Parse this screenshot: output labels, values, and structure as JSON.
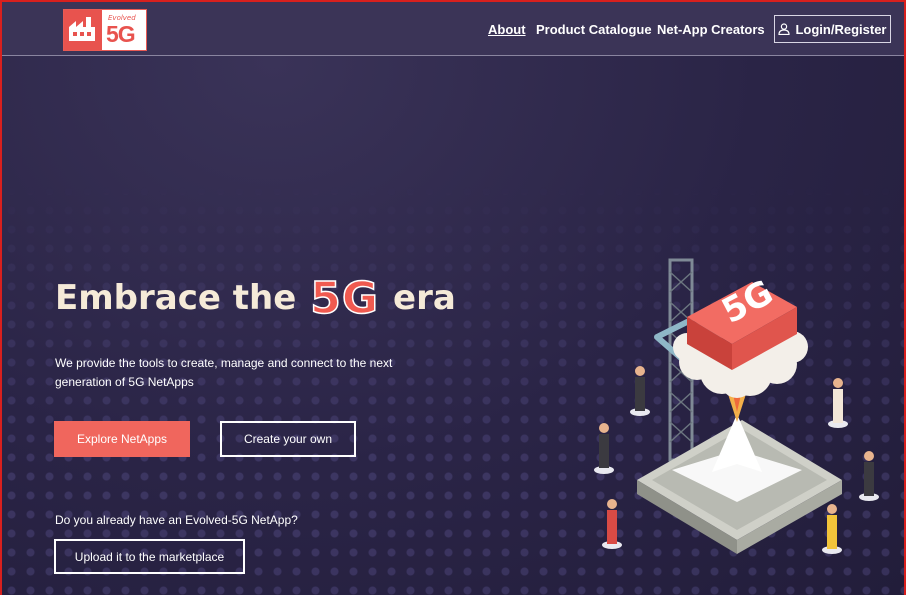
{
  "header": {
    "logo": {
      "small_text": "Evolved",
      "big_text": "5G"
    },
    "nav": {
      "about": "About",
      "catalogue": "Product Catalogue",
      "creators": "Net-App Creators",
      "login": "Login/Register"
    }
  },
  "hero": {
    "headline_before": "Embrace the",
    "headline_accent": "5G",
    "headline_after": "era",
    "subtext": "We provide the tools to create, manage and connect to the next generation of 5G NetApps",
    "explore_button": "Explore NetApps",
    "create_button": "Create your own",
    "question": "Do you already have an Evolved-5G NetApp?",
    "upload_button": "Upload it to the marketplace",
    "illustration_label": "5G"
  },
  "colors": {
    "background": "#2a2446",
    "header": "#3b3457",
    "accent": "#f0665d",
    "headline": "#f5ead8",
    "frame_border": "#d8201e"
  },
  "icons": [
    "user-icon",
    "logo-factory-icon"
  ]
}
